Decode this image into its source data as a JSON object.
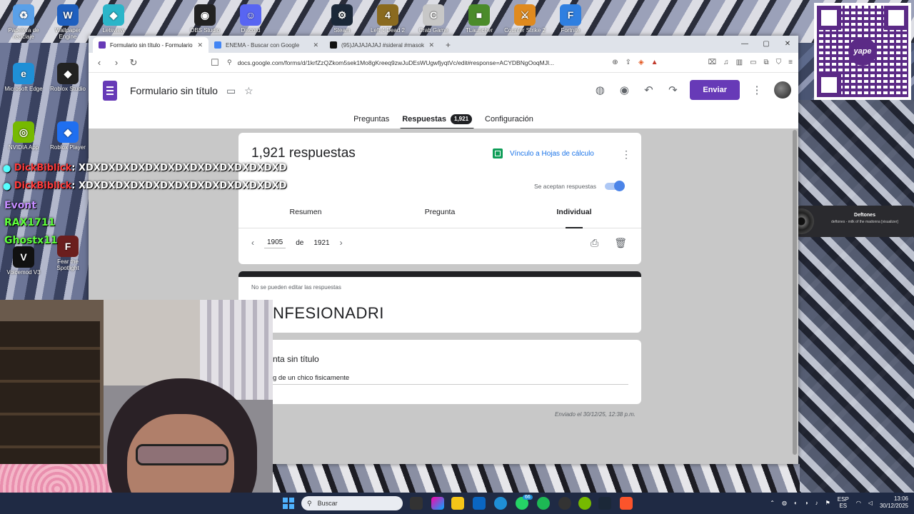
{
  "desktop": {
    "icons": [
      {
        "label": "Papelera de reciclaje",
        "color": "#5aa0e8",
        "glyph": "♻"
      },
      {
        "label": "Wallpaper Engine",
        "color": "#1e5fbf",
        "glyph": "W"
      },
      {
        "label": "Letsview",
        "color": "#2bb5c9",
        "glyph": "◆"
      },
      {
        "label": "OBS Studio",
        "color": "#222222",
        "glyph": "◉"
      },
      {
        "label": "Discord",
        "color": "#5865f2",
        "glyph": "☺"
      },
      {
        "label": "Steam",
        "color": "#1b2838",
        "glyph": "⚙"
      },
      {
        "label": "Left 4 Dead 2",
        "color": "#8a6a1f",
        "glyph": "4"
      },
      {
        "label": "Crab Game",
        "color": "#c7c7c7",
        "glyph": "C"
      },
      {
        "label": "TLauncher",
        "color": "#4b8b2a",
        "glyph": "■"
      },
      {
        "label": "Counter Strike 2",
        "color": "#e08a1e",
        "glyph": "⚔"
      },
      {
        "label": "Fortnite",
        "color": "#2f7fe0",
        "glyph": "F"
      },
      {
        "label": "Microsoft Edge",
        "color": "#1f8fd6",
        "glyph": "e"
      },
      {
        "label": "Roblox Studio",
        "color": "#222222",
        "glyph": "◆"
      },
      {
        "label": "NVIDIA App",
        "color": "#76b900",
        "glyph": "◎"
      },
      {
        "label": "Roblox Player",
        "color": "#1f6ff0",
        "glyph": "◆"
      },
      {
        "label": "Voicemod V3",
        "color": "#111111",
        "glyph": "V"
      },
      {
        "label": "Fear the Spotlight",
        "color": "#6b1e1e",
        "glyph": "F"
      }
    ],
    "chat": [
      {
        "name": "DickBiblick",
        "message": ": XDXDXDXDXDXDXDXDXDXDXDXDXDXD"
      },
      {
        "name": "DickBiblick",
        "message": ": XDXDXDXDXDXDXDXDXDXDXDXDXDXD"
      }
    ],
    "nicknames": [
      "RAX1711",
      "Ghostx11"
    ],
    "partial_overlay_text": "Evont"
  },
  "qr": {
    "logo_text": "yape"
  },
  "now_playing": {
    "title": "Deftones",
    "subtitle": "deftones - milk of the madonna [visualizer]"
  },
  "browser": {
    "tabs": [
      {
        "title": "Formulario sin título - Formulario",
        "color": "#673ab7",
        "active": true
      },
      {
        "title": "ENEMA - Buscar con Google",
        "color": "#4285f4",
        "active": false
      },
      {
        "title": "(95)JAJAJAJAJ #sideral #masoku #pa",
        "color": "#111111",
        "active": false
      }
    ],
    "new_tab": "+",
    "url": "docs.google.com/forms/d/1krfZzQZkom5sek1Mo8gKreeq9zwJuDEsWUgwfjyqtVc/edit#response=ACYDBNgOoqMJl..."
  },
  "form": {
    "title": "Formulario sin título",
    "send_label": "Enviar",
    "nav_tabs": [
      {
        "label": "Preguntas",
        "active": false
      },
      {
        "label": "Respuestas",
        "active": true,
        "badge": "1,921"
      },
      {
        "label": "Configuración",
        "active": false
      }
    ],
    "responses": {
      "count_label": "1,921 respuestas",
      "sheets_link": "Vínculo a Hojas de cálculo",
      "accepting_label": "Se aceptan respuestas",
      "accepting": true,
      "subtabs": [
        {
          "label": "Resumen",
          "active": false
        },
        {
          "label": "Pregunta",
          "active": false
        },
        {
          "label": "Individual",
          "active": true
        }
      ],
      "current": "1905",
      "of_label": "de",
      "total": "1921"
    },
    "response_card": {
      "notice": "No se pueden editar las respuestas",
      "form_heading": "NFESIONADRI"
    },
    "question_card": {
      "question": "nta sin título",
      "answer": "g de un chico fisicamente"
    },
    "sent_label": "Enviado el 30/12/25, 12:38 p.m."
  },
  "taskbar": {
    "search_placeholder": "Buscar",
    "whatsapp_badge": "66",
    "lang": "ESP",
    "lang_sub": "ES",
    "time": "13:06",
    "date": "30/12/2025"
  }
}
